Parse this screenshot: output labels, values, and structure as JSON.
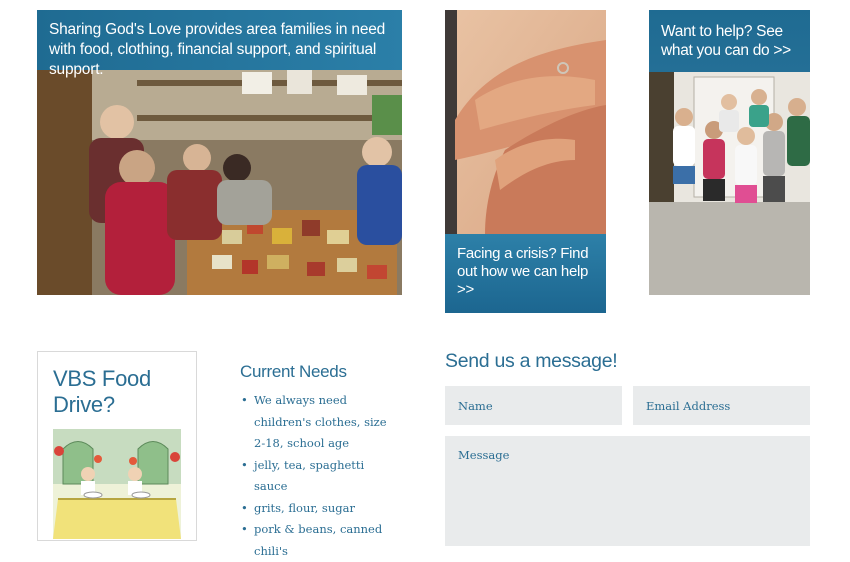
{
  "tiles": {
    "pantry": {
      "text": "Sharing God's Love provides area families in need with food, clothing, financial support, and spiritual support."
    },
    "crisis": {
      "text": "Facing a crisis? Find out how we can help >>"
    },
    "help": {
      "text": "Want to help? See what you can do >>"
    }
  },
  "vbs": {
    "title": "VBS Food Drive?"
  },
  "needs": {
    "heading": "Current Needs",
    "items": [
      "We always need children's clothes, size 2-18, school age",
      "jelly, tea, spaghetti sauce",
      "grits, flour, sugar",
      "pork & beans, canned chili's"
    ]
  },
  "contact": {
    "heading": "Send us a message!",
    "name_placeholder": "Name",
    "email_placeholder": "Email Address",
    "message_placeholder": "Message"
  },
  "colors": {
    "brand_blue": "#2b6e93",
    "banner_blue": "#1f6b92",
    "field_bg": "#e9ebec"
  }
}
